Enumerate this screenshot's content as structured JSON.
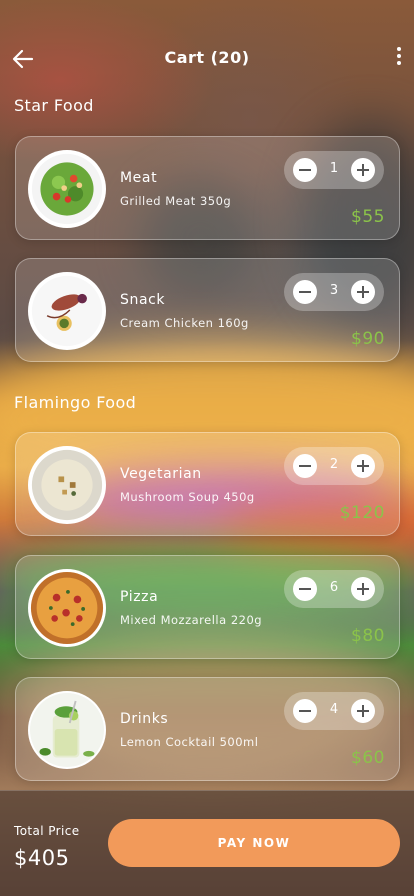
{
  "header": {
    "title": "Cart (20)",
    "back_icon": "arrow-left-icon",
    "more_icon": "more-vertical-icon"
  },
  "sections": [
    {
      "title": "Star Food",
      "items": [
        {
          "name": "Meat",
          "description": "Grilled Meat 350g",
          "quantity": "1",
          "price": "$55",
          "image_icon": "salad-plate-icon"
        },
        {
          "name": "Snack",
          "description": "Cream Chicken 160g",
          "quantity": "3",
          "price": "$90",
          "image_icon": "chicken-plate-icon"
        }
      ]
    },
    {
      "title": "Flamingo Food",
      "items": [
        {
          "name": "Vegetarian",
          "description": "Mushroom Soup 450g",
          "quantity": "2",
          "price": "$120",
          "image_icon": "soup-bowl-icon"
        },
        {
          "name": "Pizza",
          "description": "Mixed Mozzarella 220g",
          "quantity": "6",
          "price": "$80",
          "image_icon": "pizza-icon"
        },
        {
          "name": "Drinks",
          "description": "Lemon Cocktail 500ml",
          "quantity": "4",
          "price": "$60",
          "image_icon": "cocktail-glass-icon"
        }
      ]
    }
  ],
  "footer": {
    "total_label": "Total Price",
    "total_value": "$405",
    "pay_label": "PAY NOW"
  },
  "colors": {
    "price": "#8bc34a",
    "pay_button": "#f29a5a"
  }
}
